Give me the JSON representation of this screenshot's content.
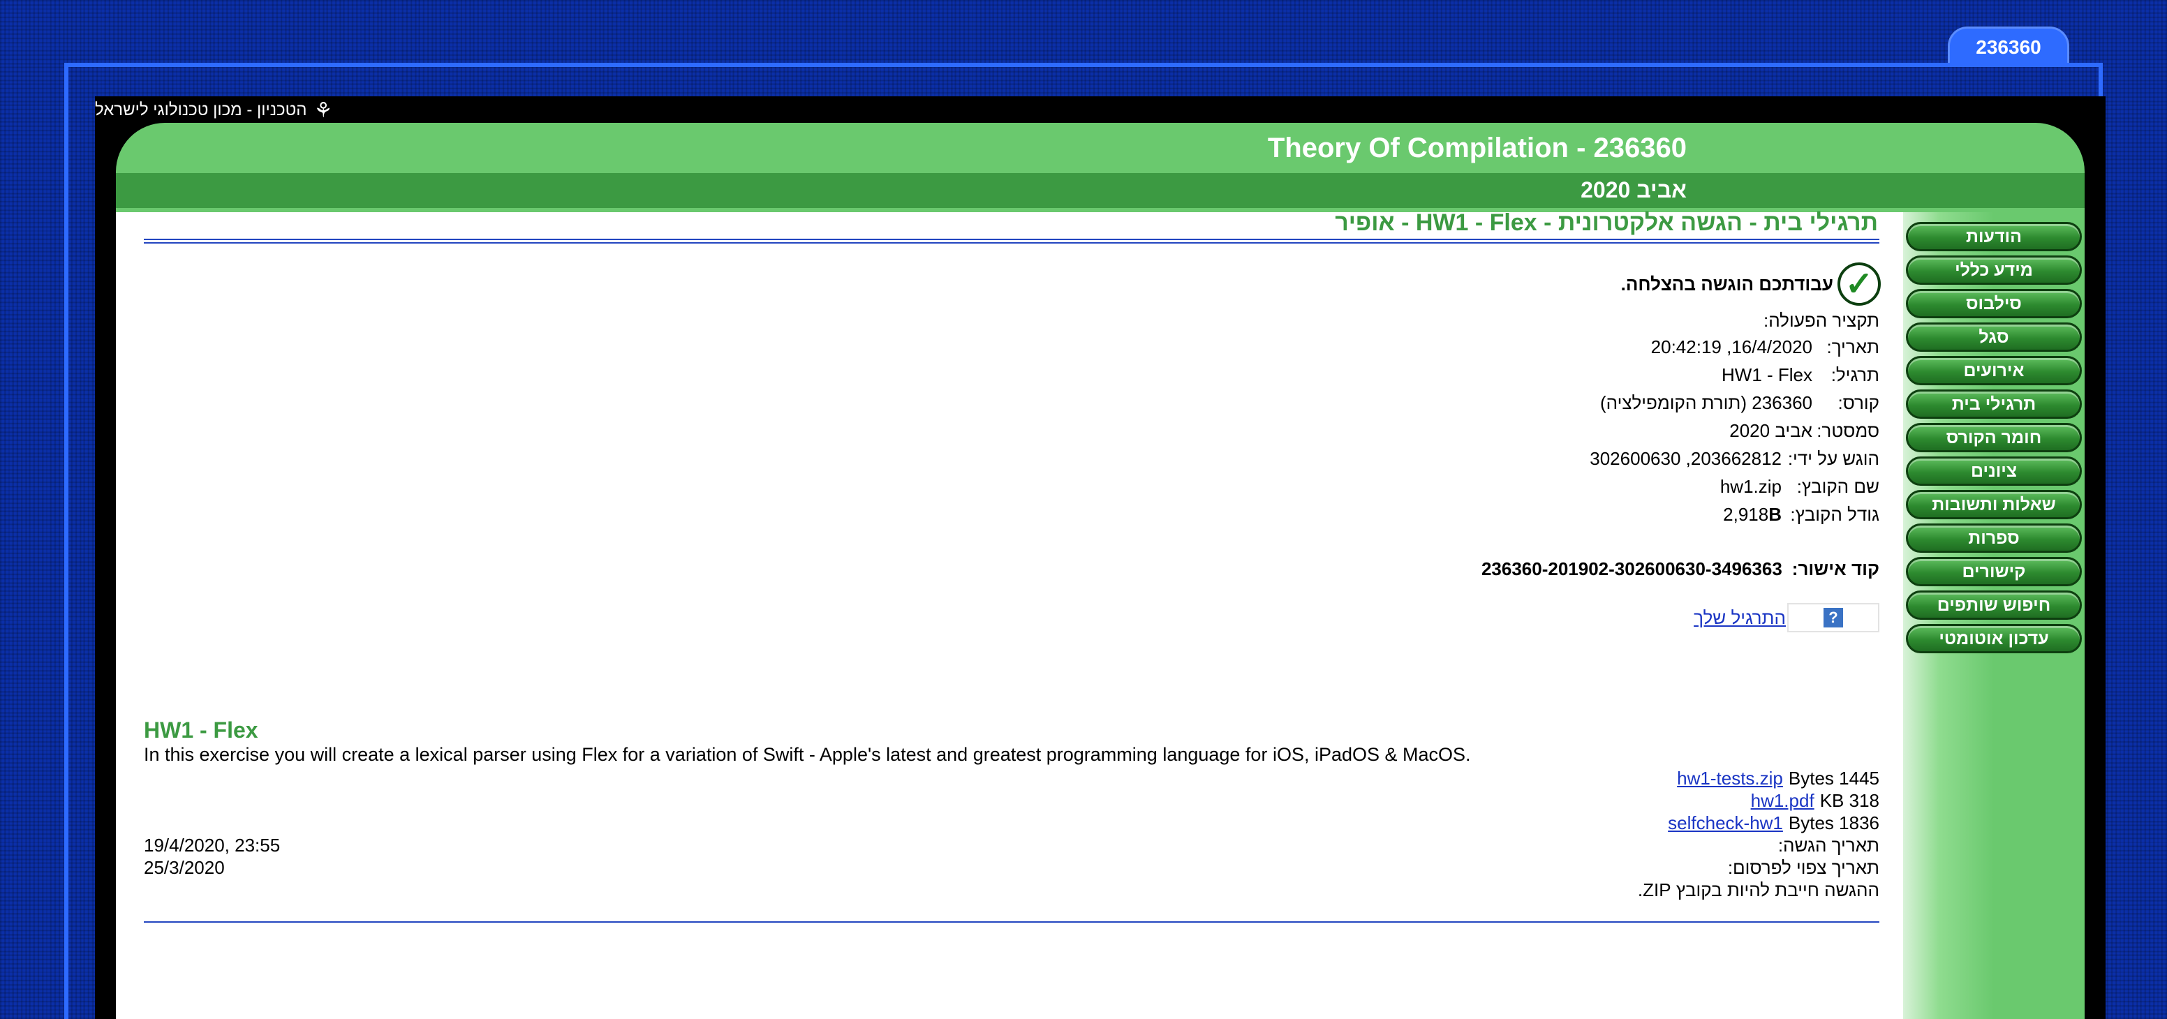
{
  "course_tab": "236360",
  "technion": {
    "name": "הטכניון - מכון טכנולוגי לישראל",
    "logo_icon": "technion-logo-icon"
  },
  "header": {
    "title": "Theory Of Compilation - 236360",
    "semester": "אביב 2020"
  },
  "nav": [
    {
      "label": "הודעות"
    },
    {
      "label": "מידע כללי"
    },
    {
      "label": "סילבוס"
    },
    {
      "label": "סגל"
    },
    {
      "label": "אירועים"
    },
    {
      "label": "תרגילי בית"
    },
    {
      "label": "חומר הקורס"
    },
    {
      "label": "ציונים"
    },
    {
      "label": "שאלות ותשובות"
    },
    {
      "label": "ספרות"
    },
    {
      "label": "קישורים"
    },
    {
      "label": "חיפוש שותפים"
    },
    {
      "label": "עדכון אוטומטי"
    }
  ],
  "page_heading": "תרגילי בית - הגשה אלקטרונית - HW1 - Flex - אופיר",
  "submission": {
    "success_message": "עבודתכם הוגשה בהצלחה.",
    "summary_title": "תקציר הפעולה:",
    "rows": [
      {
        "label": "תאריך:",
        "value": "16/4/2020, 20:42:19"
      },
      {
        "label": "תרגיל:",
        "value": "HW1 - Flex"
      },
      {
        "label": "קורס:",
        "value": "236360 (תורת הקומפילציה)"
      },
      {
        "label": "סמסטר:",
        "value": "אביב 2020"
      },
      {
        "label": "הוגש על ידי:",
        "value": "203662812, 302600630"
      },
      {
        "label": "שם הקובץ:",
        "value": "hw1.zip"
      },
      {
        "label": "גודל הקובץ:",
        "value": "2,918",
        "unit": "B"
      }
    ],
    "approval_label": "קוד אישור:",
    "approval_code": "236360-201902-302600630-3496363",
    "help_icon": "?",
    "prev_link": "התרגיל שלך"
  },
  "homework": {
    "title": "HW1 - Flex",
    "description": "In this exercise you will create a lexical parser using Flex for a variation of Swift - Apple's latest and greatest programming language for iOS, iPadOS & MacOS.",
    "files": [
      {
        "name": "hw1-tests.zip",
        "size": "1445 Bytes"
      },
      {
        "name": "hw1.pdf",
        "size": "318 KB"
      },
      {
        "name": "selfcheck-hw1",
        "size": "1836 Bytes"
      }
    ],
    "due_label": "תאריך הגשה:",
    "due_value": "19/4/2020, 23:55",
    "publish_label": "תאריך צפוי לפרסום:",
    "publish_value": "25/3/2020",
    "zip_note": "ההגשה חייבת להיות בקובץ ZIP."
  }
}
